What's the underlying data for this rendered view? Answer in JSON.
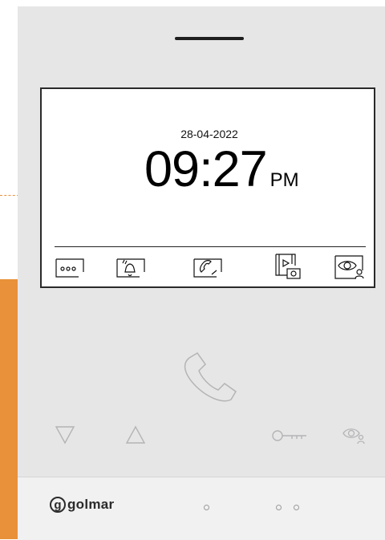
{
  "device": {
    "brand": "golmar",
    "brand_initial": "g",
    "screen": {
      "date": "28-04-2022",
      "time": "09:27",
      "ampm": "PM",
      "menu_items": [
        {
          "name": "more-options",
          "icon": "dots-icon"
        },
        {
          "name": "do-not-disturb",
          "icon": "bell-icon"
        },
        {
          "name": "intercom-call",
          "icon": "handset-icon"
        },
        {
          "name": "media-gallery",
          "icon": "film-camera-icon"
        },
        {
          "name": "monitor-view",
          "icon": "eye-user-icon"
        }
      ]
    },
    "panel_buttons": [
      {
        "name": "down",
        "icon": "triangle-down-icon"
      },
      {
        "name": "up",
        "icon": "triangle-up-icon"
      },
      {
        "name": "talk",
        "icon": "phone-icon"
      },
      {
        "name": "door-release",
        "icon": "key-icon"
      },
      {
        "name": "monitor",
        "icon": "eye-user-icon"
      }
    ]
  },
  "colors": {
    "device_body": "#e6e6e7",
    "accent_orange": "#e8913a",
    "screen_bg": "#ffffff",
    "icon_gray": "#b4b4b6"
  }
}
